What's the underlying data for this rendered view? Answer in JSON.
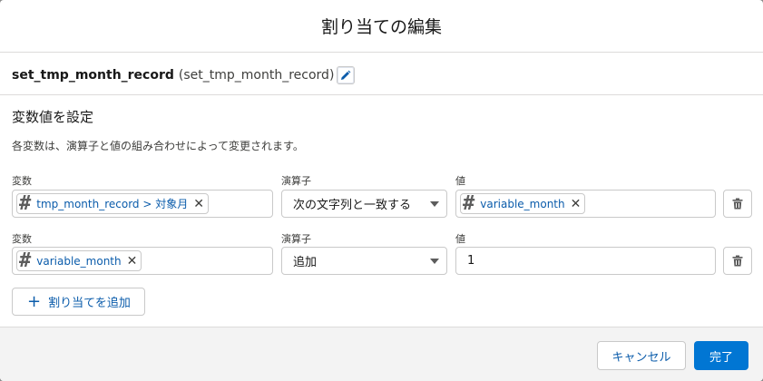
{
  "modal": {
    "title": "割り当ての編集"
  },
  "element": {
    "api_name": "set_tmp_month_record",
    "label": "(set_tmp_month_record)"
  },
  "section": {
    "title": "変数値を設定",
    "description": "各変数は、演算子と値の組み合わせによって変更されます。"
  },
  "rows": [
    {
      "variable_label": "変数",
      "variable_pill": "tmp_month_record > 対象月",
      "operator_label": "演算子",
      "operator_value": "次の文字列と一致する",
      "value_label": "値",
      "value_pill": "variable_month"
    },
    {
      "variable_label": "変数",
      "variable_pill": "variable_month",
      "operator_label": "演算子",
      "operator_value": "追加",
      "value_label": "値",
      "value_text": "1"
    }
  ],
  "add_button": {
    "label": "割り当てを追加"
  },
  "footer": {
    "cancel_label": "キャンセル",
    "done_label": "完了"
  },
  "colors": {
    "brand": "#0176d3",
    "link": "#0b5cab",
    "border": "#c9c9c9"
  },
  "icons": [
    "pencil-icon",
    "hash-icon",
    "close-icon",
    "chevron-down-icon",
    "trash-icon",
    "plus-icon"
  ]
}
